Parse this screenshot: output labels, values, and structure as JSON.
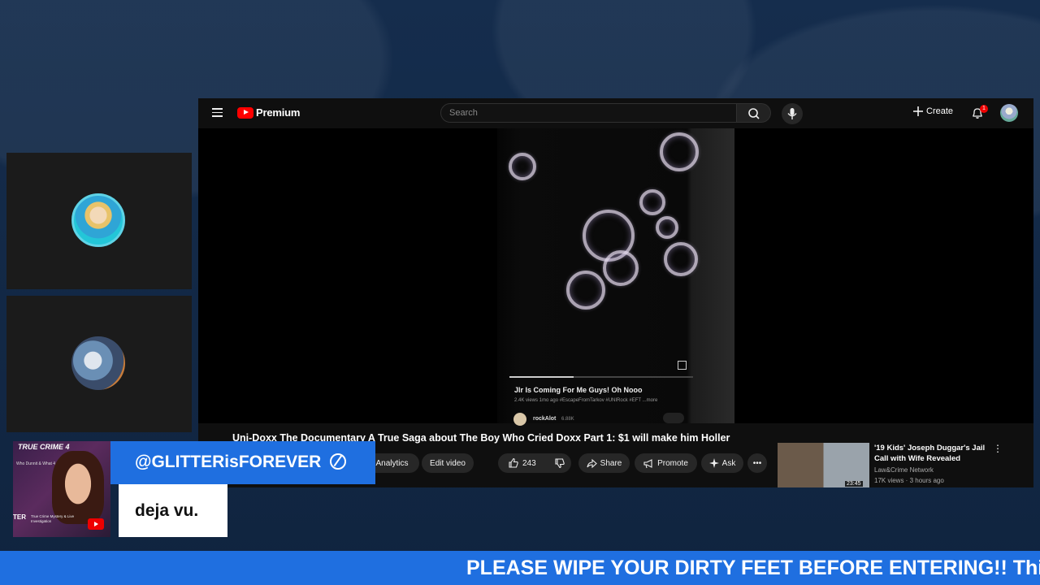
{
  "youtube": {
    "logo_text": "Premium",
    "search_placeholder": "Search",
    "create_label": "Create",
    "notification_count": "1",
    "short": {
      "title": "Jlr Is Coming For Me Guys! Oh Nooo",
      "meta": "2.4K views  1mo ago  #EscapeFromTarkov #UNIRock #EFT  ...more",
      "channel": "rockAlot",
      "subs": "6.88K"
    },
    "video_title": "Uni-Doxx The Documentary A True Saga about The Boy Who Cried Doxx Part 1: $1 will make him Holler",
    "buttons": {
      "analytics": "Analytics",
      "edit_video": "Edit video",
      "likes": "243",
      "share": "Share",
      "promote": "Promote",
      "ask": "Ask",
      "more": "•••"
    },
    "suggestion": {
      "title": "'19 Kids' Joseph Duggar's Jail Call with Wife Revealed",
      "channel": "Law&Crime Network",
      "meta": "17K views · 3 hours ago",
      "duration": "23:45"
    }
  },
  "overlay": {
    "profile_card": {
      "title": "TRUE CRIME 4",
      "subtitle": "Who Dunnit & What 4",
      "name": "TER",
      "desc": "True Crime Mystery & Live Investigation"
    },
    "chat_username": "@GLITTERisFOREVER",
    "chat_message": "deja vu.",
    "ticker_text": "PLEASE WIPE YOUR DIRTY FEET BEFORE ENTERING!! Thi"
  },
  "colors": {
    "overlay_blue": "#1f6fe0",
    "youtube_red": "#ff0000",
    "background": "#132a48"
  },
  "icons": [
    "menu-icon",
    "youtube-logo-icon",
    "search-icon",
    "mic-icon",
    "plus-icon",
    "bell-icon",
    "fullscreen-icon",
    "thumbs-up-icon",
    "thumbs-down-icon",
    "share-icon",
    "megaphone-icon",
    "sparkle-icon",
    "more-icon",
    "moderator-icon",
    "youtube-play-icon"
  ]
}
